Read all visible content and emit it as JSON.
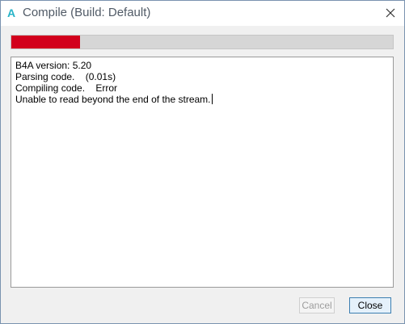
{
  "window": {
    "title": "Compile (Build: Default)",
    "app_icon_glyph": "A",
    "accent_color": "#27b3c8"
  },
  "progress": {
    "percent": 18,
    "fill_color": "#d2001c",
    "track_color": "#d6d6d6"
  },
  "log": {
    "lines": [
      "B4A version: 5.20",
      "Parsing code.    (0.01s)",
      "Compiling code.    Error",
      "Unable to read beyond the end of the stream."
    ]
  },
  "buttons": {
    "cancel_label": "Cancel",
    "close_label": "Close"
  },
  "icons": {
    "app": "b4a-app-icon",
    "close": "close-icon"
  }
}
